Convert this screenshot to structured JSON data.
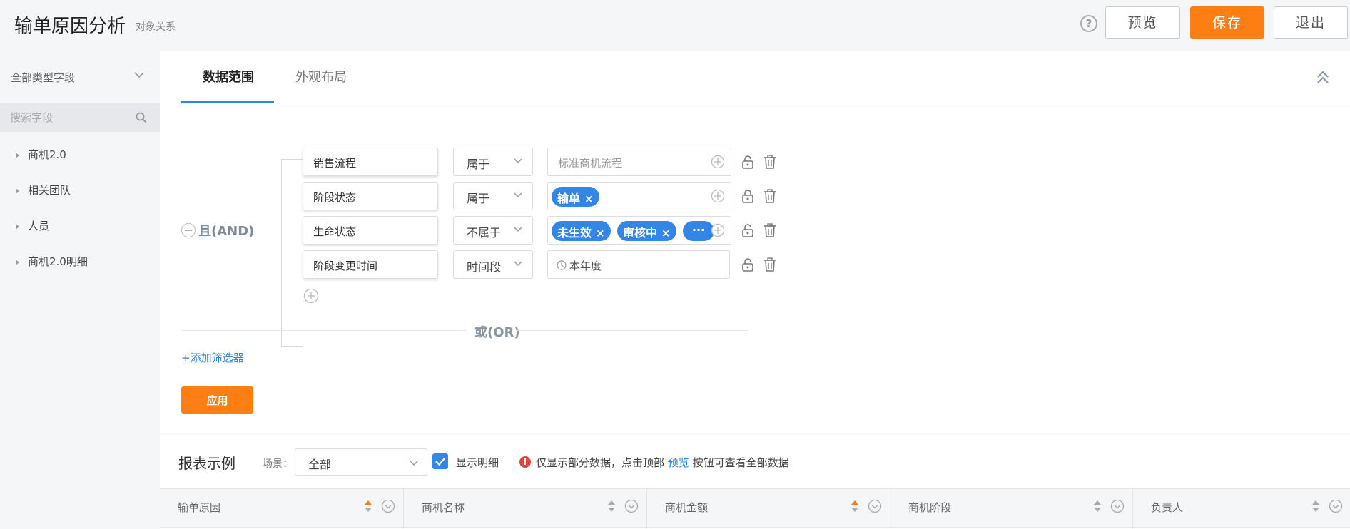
{
  "header": {
    "title": "输单原因分析",
    "subtitle": "对象关系",
    "help_glyph": "?",
    "preview_label": "预览",
    "save_label": "保存",
    "exit_label": "退出"
  },
  "sidebar": {
    "field_type": "全部类型字段",
    "search_placeholder": "搜索字段",
    "items": [
      {
        "label": "商机2.0"
      },
      {
        "label": "相关团队"
      },
      {
        "label": "人员"
      },
      {
        "label": "商机2.0明细"
      }
    ]
  },
  "tabs": [
    {
      "label": "数据范围",
      "active": true
    },
    {
      "label": "外观布局",
      "active": false
    }
  ],
  "filters": {
    "group_label": "且(AND)",
    "conditions": [
      {
        "field": "销售流程",
        "operator": "属于",
        "placeholder": "标准商机流程",
        "tags": []
      },
      {
        "field": "阶段状态",
        "operator": "属于",
        "tags": [
          "输单"
        ]
      },
      {
        "field": "生命状态",
        "operator": "不属于",
        "tags": [
          "未生效",
          "审核中"
        ],
        "more": "···"
      },
      {
        "field": "阶段变更时间",
        "operator": "时间段",
        "value": "本年度"
      }
    ],
    "or_label": "或(OR)",
    "add_filter_label": "+添加筛选器",
    "apply_label": "应用",
    "tag_close_glyph": "×"
  },
  "report": {
    "title": "报表示例",
    "scene_label": "场景：",
    "scene_value": "全部",
    "show_detail_label": "显示明细",
    "show_detail_checked": true,
    "warn_glyph": "!",
    "notice_before": "仅显示部分数据，点击顶部",
    "notice_link": "预览",
    "notice_after": "按钮可查看全部数据",
    "columns": [
      {
        "label": "输单原因",
        "sort_active": true
      },
      {
        "label": "商机名称",
        "sort_active": false
      },
      {
        "label": "商机金额",
        "sort_active": true
      },
      {
        "label": "商机阶段",
        "sort_active": false
      },
      {
        "label": "负责人",
        "sort_active": false
      }
    ]
  },
  "colors": {
    "accent_orange": "#fd7f14",
    "accent_blue": "#2c87e0",
    "tag_blue": "#3486e6",
    "warn_red": "#e0413c"
  }
}
